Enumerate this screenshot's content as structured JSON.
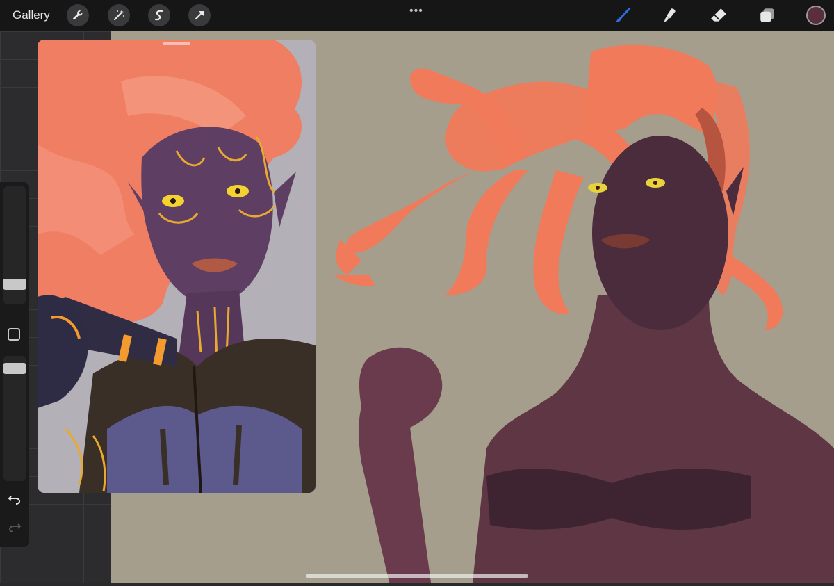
{
  "topbar": {
    "gallery_label": "Gallery",
    "more_label": "•••",
    "tools": [
      "wrench-icon",
      "magic-wand-icon",
      "selection-icon",
      "transform-arrow-icon"
    ],
    "right_tools": [
      "brush-icon",
      "smudge-icon",
      "eraser-icon",
      "layers-icon"
    ],
    "active_tool": "brush",
    "active_color": "#5a2e3a",
    "accent_color": "#2f6fe6"
  },
  "sidebar": {
    "items": [
      "brush-size-slider",
      "modify-button",
      "opacity-slider",
      "undo-icon",
      "redo-icon"
    ]
  },
  "colors": {
    "canvas_bg": "#a69e8d",
    "hair": "#f07a5a",
    "skin_reference": "#5a3a55",
    "skin_canvas": "#5e3644"
  }
}
